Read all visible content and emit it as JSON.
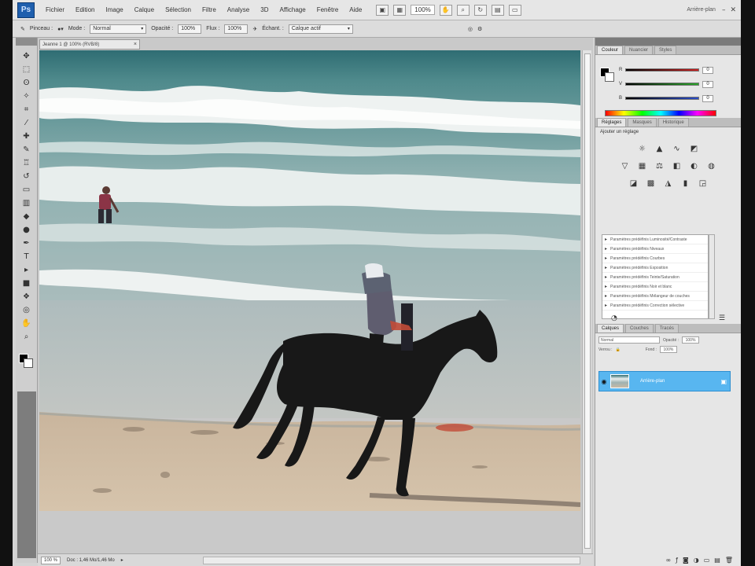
{
  "menubar": {
    "logo": "Ps",
    "items": [
      "Fichier",
      "Edition",
      "Image",
      "Calque",
      "Sélection",
      "Filtre",
      "Analyse",
      "3D",
      "Affichage",
      "Fenêtre",
      "Aide"
    ],
    "zoom": "100%",
    "workspace_label": "Arrière-plan"
  },
  "optionsbar": {
    "tool_label": "Pinceau :",
    "mode_label": "Mode :",
    "mode_value": "Normal",
    "opacity_label": "Opacité :",
    "opacity_value": "100%",
    "flow_label": "Flux :",
    "flow_value": "100%",
    "sample_label": "Échant. :",
    "sample_value": "Calque actif"
  },
  "document": {
    "tab_title": "Jeanne 1 @ 100% (RVB/8)",
    "status_zoom": "100 %",
    "status_doc": "Doc : 1,46 Mo/1,46 Mo"
  },
  "panels": {
    "color_tabs": [
      "Couleur",
      "Nuancier",
      "Styles"
    ],
    "color_rows": [
      {
        "label": "R",
        "value": "0",
        "color": "#c92020"
      },
      {
        "label": "V",
        "value": "0",
        "color": "#2aa52a"
      },
      {
        "label": "B",
        "value": "0",
        "color": "#2a4dc9"
      }
    ],
    "adjust_tabs": [
      "Réglages",
      "Masques",
      "Historique"
    ],
    "adjust_title": "Ajouter un réglage",
    "presets": [
      "Paramètres prédéfinis Luminosité/Contraste",
      "Paramètres prédéfinis Niveaux",
      "Paramètres prédéfinis Courbes",
      "Paramètres prédéfinis Exposition",
      "Paramètres prédéfinis Teinte/Saturation",
      "Paramètres prédéfinis Noir et blanc",
      "Paramètres prédéfinis Mélangeur de couches",
      "Paramètres prédéfinis Correction sélective"
    ],
    "layers_tabs": [
      "Calques",
      "Couches",
      "Tracés"
    ],
    "blend_mode": "Normal",
    "opacity_label": "Opacité :",
    "opacity_value": "100%",
    "lock_label": "Verrou :",
    "fill_label": "Fond :",
    "fill_value": "100%",
    "layer_name": "Arrière-plan"
  },
  "colors": {
    "selection": "#58b6f0",
    "chrome": "#d4d4d4"
  }
}
